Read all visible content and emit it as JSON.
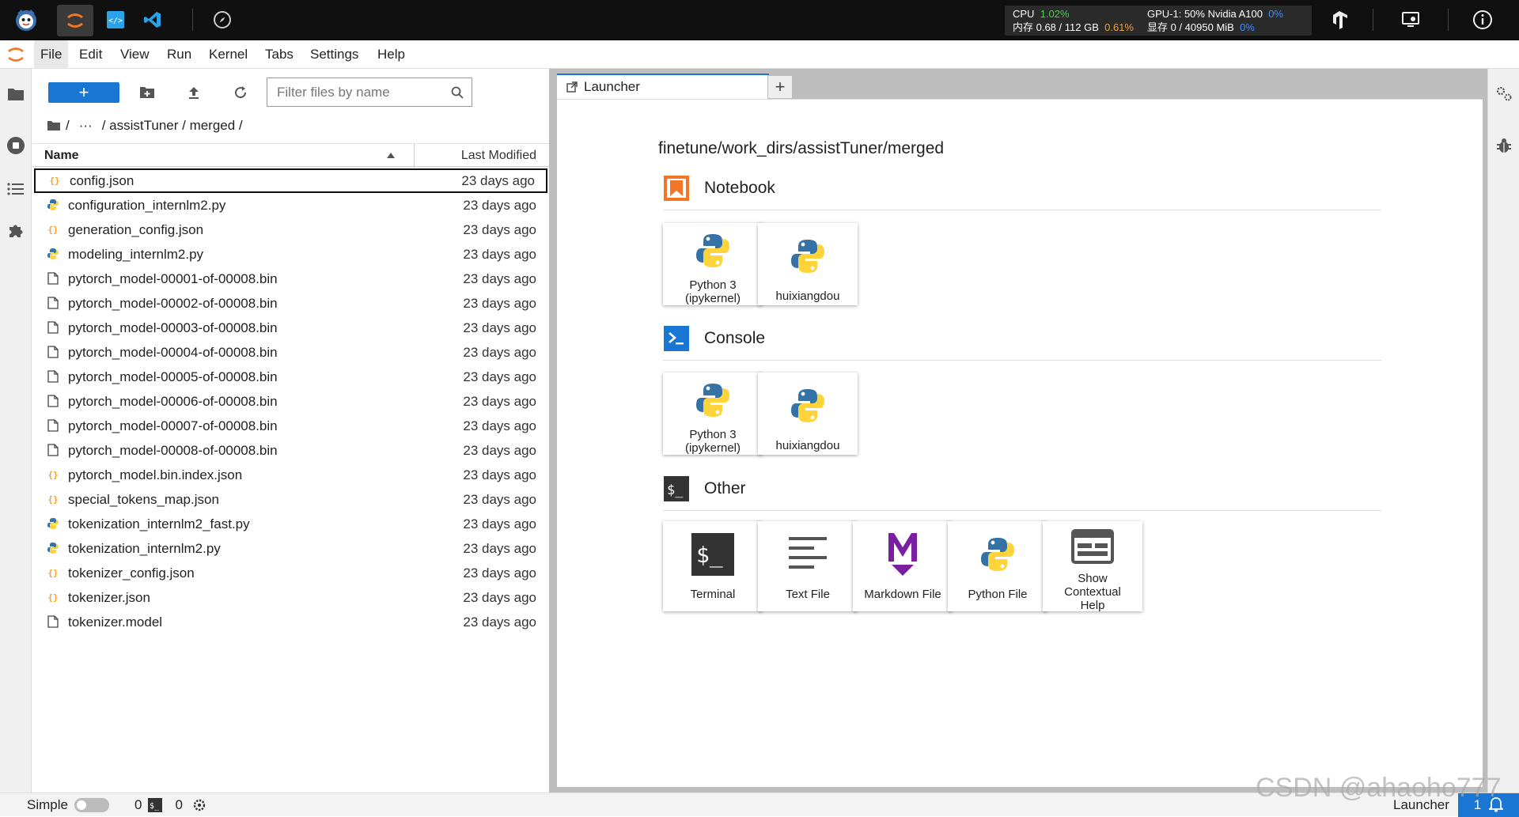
{
  "system": {
    "cpu_label": "CPU",
    "cpu_pct": "1.02%",
    "mem_label": "内存 0.68 / 112 GB",
    "mem_pct": "0.61%",
    "gpu_label": "GPU-1: 50% Nvidia A100",
    "gpu_pct": "0%",
    "vram_label": "显存 0 / 40950 MiB",
    "vram_pct": "0%"
  },
  "menu": [
    "File",
    "Edit",
    "View",
    "Run",
    "Kernel",
    "Tabs",
    "Settings",
    "Help"
  ],
  "filebrowser": {
    "new_label": "+",
    "filter_placeholder": "Filter files by name",
    "breadcrumb": {
      "root": "/",
      "ellipsis": "···",
      "path": "/ assistTuner / merged /"
    },
    "col_name": "Name",
    "col_modified": "Last Modified",
    "files": [
      {
        "name": "config.json",
        "type": "json",
        "modified": "23 days ago",
        "selected": true
      },
      {
        "name": "configuration_internlm2.py",
        "type": "py",
        "modified": "23 days ago"
      },
      {
        "name": "generation_config.json",
        "type": "json",
        "modified": "23 days ago"
      },
      {
        "name": "modeling_internlm2.py",
        "type": "py",
        "modified": "23 days ago"
      },
      {
        "name": "pytorch_model-00001-of-00008.bin",
        "type": "file",
        "modified": "23 days ago"
      },
      {
        "name": "pytorch_model-00002-of-00008.bin",
        "type": "file",
        "modified": "23 days ago"
      },
      {
        "name": "pytorch_model-00003-of-00008.bin",
        "type": "file",
        "modified": "23 days ago"
      },
      {
        "name": "pytorch_model-00004-of-00008.bin",
        "type": "file",
        "modified": "23 days ago"
      },
      {
        "name": "pytorch_model-00005-of-00008.bin",
        "type": "file",
        "modified": "23 days ago"
      },
      {
        "name": "pytorch_model-00006-of-00008.bin",
        "type": "file",
        "modified": "23 days ago"
      },
      {
        "name": "pytorch_model-00007-of-00008.bin",
        "type": "file",
        "modified": "23 days ago"
      },
      {
        "name": "pytorch_model-00008-of-00008.bin",
        "type": "file",
        "modified": "23 days ago"
      },
      {
        "name": "pytorch_model.bin.index.json",
        "type": "json",
        "modified": "23 days ago"
      },
      {
        "name": "special_tokens_map.json",
        "type": "json",
        "modified": "23 days ago"
      },
      {
        "name": "tokenization_internlm2_fast.py",
        "type": "py",
        "modified": "23 days ago"
      },
      {
        "name": "tokenization_internlm2.py",
        "type": "py",
        "modified": "23 days ago"
      },
      {
        "name": "tokenizer_config.json",
        "type": "json",
        "modified": "23 days ago"
      },
      {
        "name": "tokenizer.json",
        "type": "json",
        "modified": "23 days ago"
      },
      {
        "name": "tokenizer.model",
        "type": "file",
        "modified": "23 days ago"
      }
    ]
  },
  "tab": {
    "title": "Launcher",
    "add_label": "+"
  },
  "launcher": {
    "path": "finetune/work_dirs/assistTuner/merged",
    "sections": {
      "notebook": {
        "title": "Notebook",
        "cards": [
          "Python 3\n(ipykernel)",
          "huixiangdou"
        ]
      },
      "console": {
        "title": "Console",
        "cards": [
          "Python 3\n(ipykernel)",
          "huixiangdou"
        ]
      },
      "other": {
        "title": "Other",
        "cards": [
          "Terminal",
          "Text File",
          "Markdown File",
          "Python File",
          "Show\nContextual\nHelp"
        ]
      }
    }
  },
  "status": {
    "mode": "Simple",
    "kernels": "0",
    "terminals": "0",
    "current": "Launcher",
    "notifications": "1"
  },
  "watermark": "CSDN @ahaoho777",
  "colors": {
    "accent": "#1976d2",
    "notebook": "#f37626",
    "console": "#1976d2",
    "terminal": "#333333",
    "markdown": "#7b1fa2"
  }
}
